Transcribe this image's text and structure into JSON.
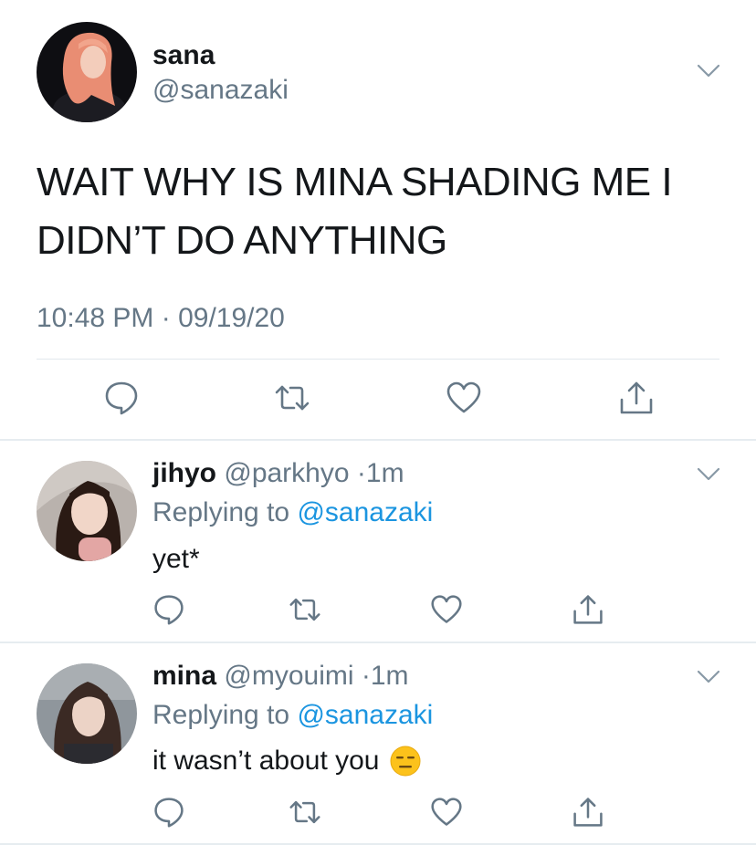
{
  "main_tweet": {
    "display_name": "sana",
    "handle": "@sanazaki",
    "text": "WAIT WHY IS MINA SHADING ME I DIDN’T DO ANYTHING",
    "timestamp": "10:48 PM · 09/19/20",
    "avatar_icon": "avatar-sana",
    "menu_icon": "chevron-down-icon"
  },
  "actions": {
    "reply_icon": "reply-icon",
    "retweet_icon": "retweet-icon",
    "like_icon": "heart-icon",
    "share_icon": "share-icon"
  },
  "replies": [
    {
      "display_name": "jihyo",
      "handle": "@parkhyo",
      "separator": "·",
      "age": "1m",
      "replying_prefix": "Replying to",
      "replying_mention": "@sanazaki",
      "text": "yet*"
    },
    {
      "display_name": "mina",
      "handle": "@myouimi",
      "separator": "·",
      "age": "1m",
      "replying_prefix": "Replying to",
      "replying_mention": "@sanazaki",
      "text": "it wasn’t about you",
      "emoji_icon": "expressionless-face-emoji"
    }
  ],
  "colors": {
    "text_primary": "#14171a",
    "text_secondary": "#657786",
    "link": "#1b95e0",
    "divider": "#e1e8ed"
  }
}
